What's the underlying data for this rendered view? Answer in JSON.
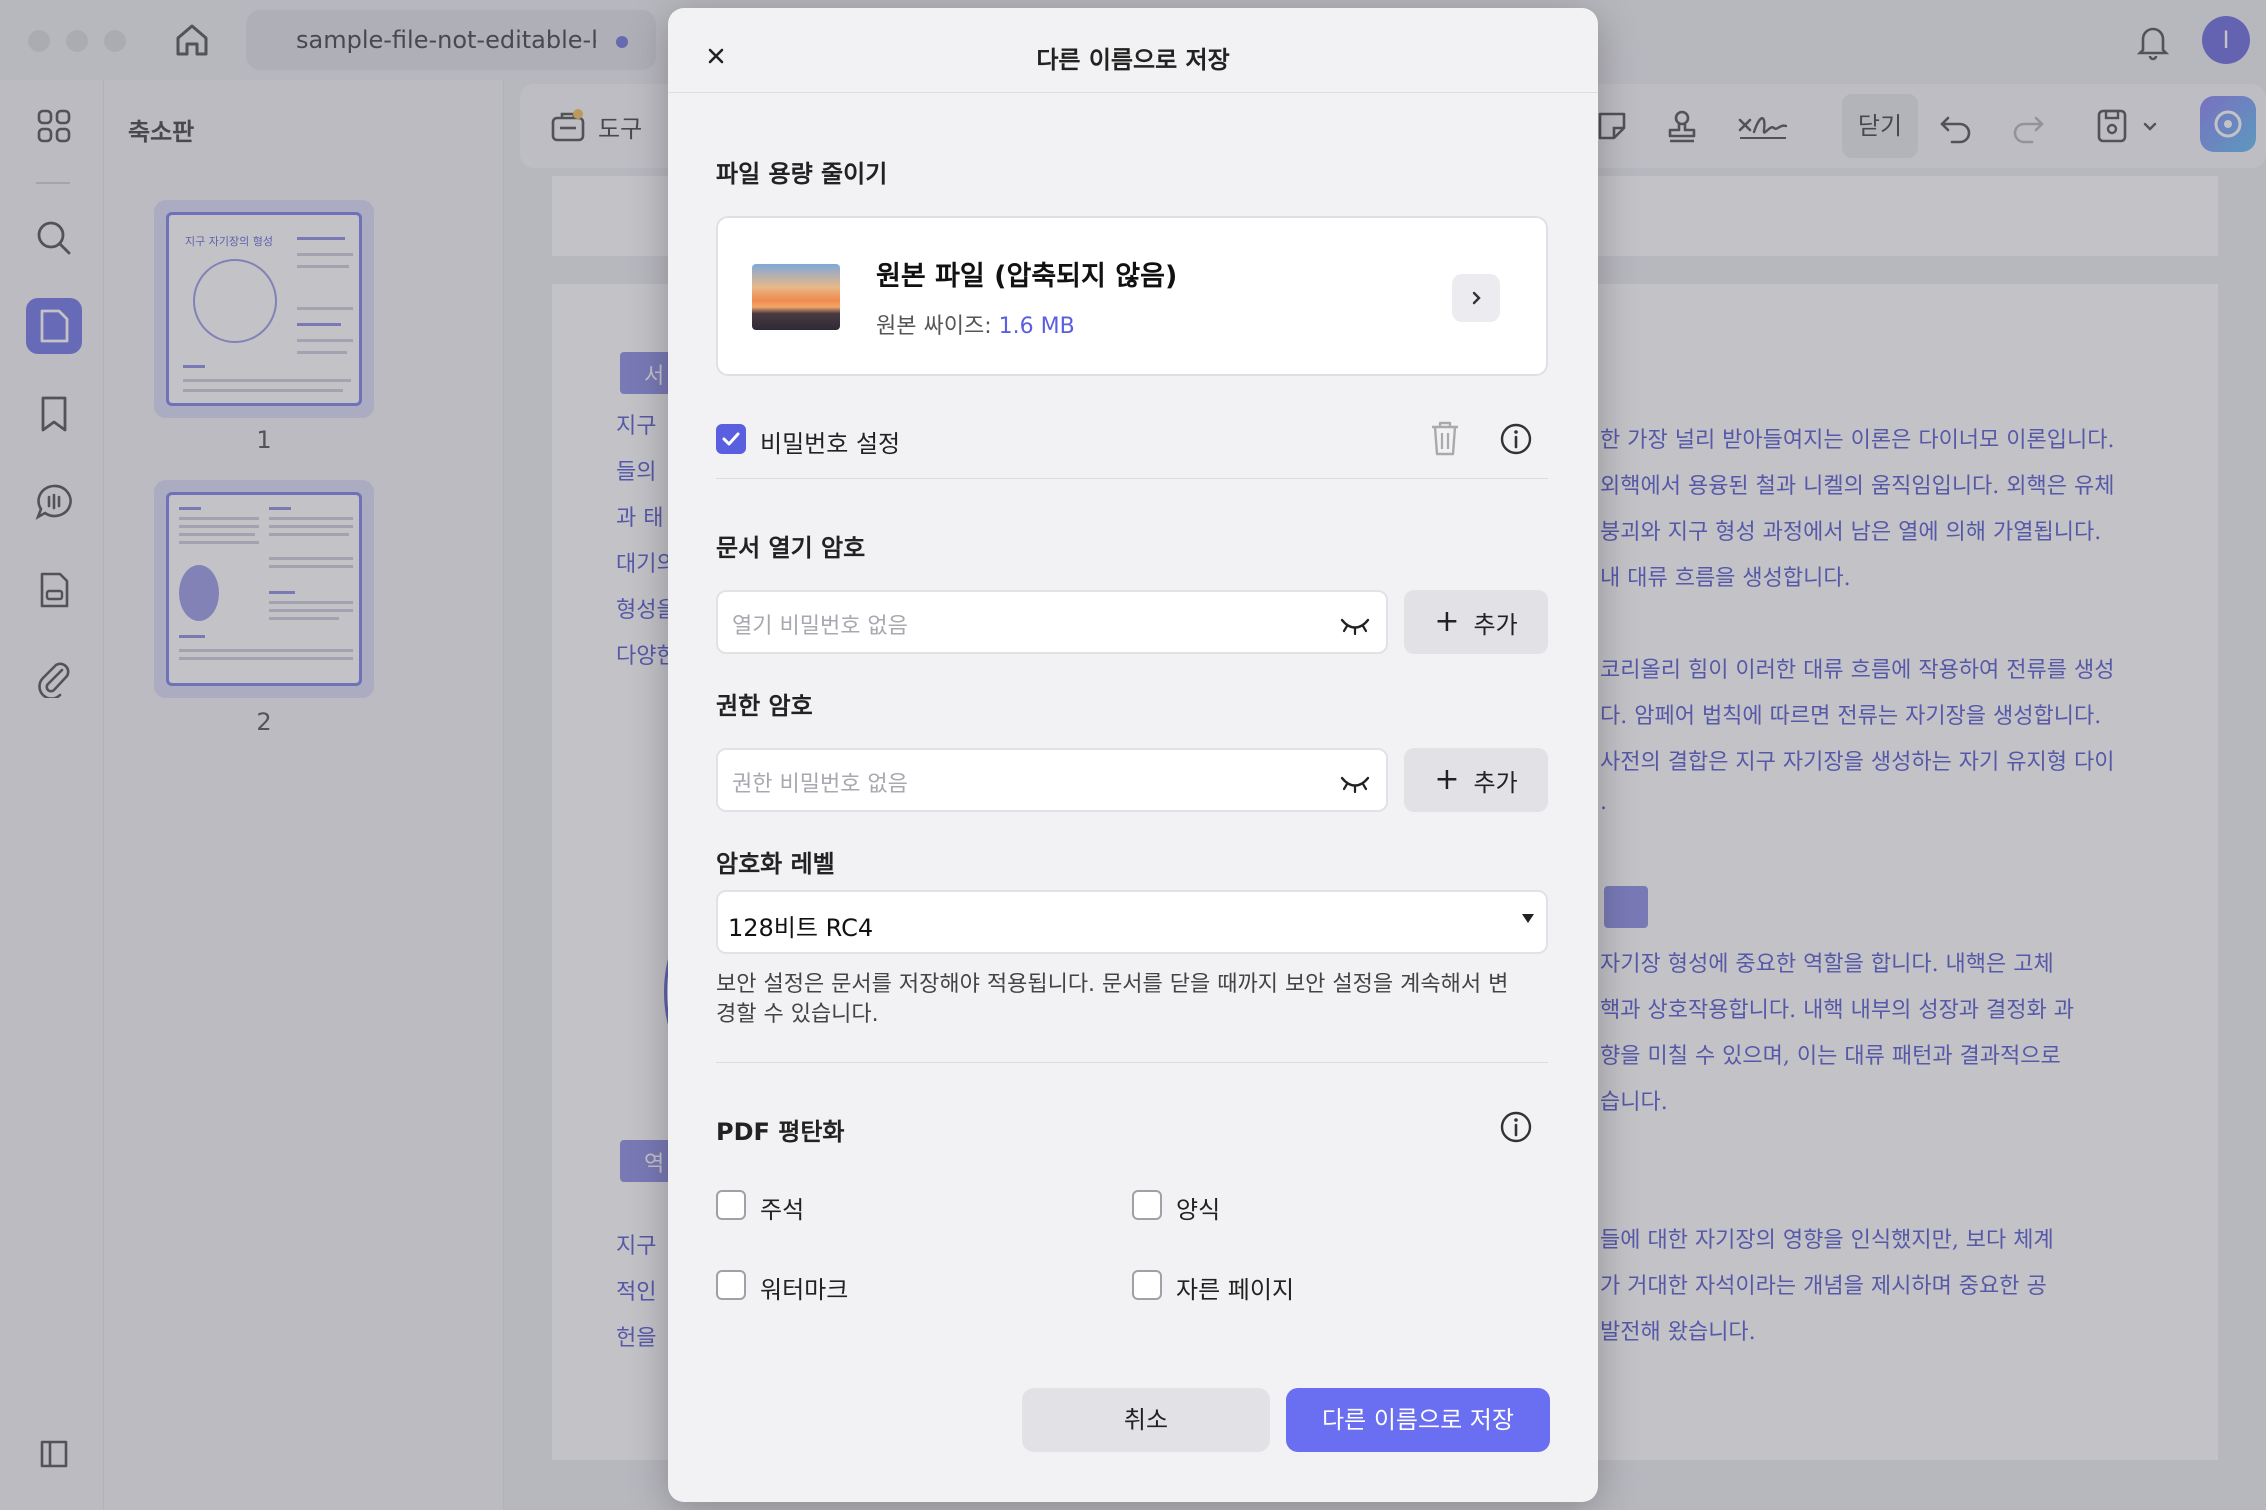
{
  "titlebar": {
    "tab_title": "sample-file-not-editable-k",
    "user_initial": "I"
  },
  "thumbnails": {
    "title": "축소판",
    "pages": [
      {
        "label": "1",
        "heading": "지구 자기장의 형성"
      },
      {
        "label": "2"
      }
    ]
  },
  "toolbar": {
    "tools_label": "도구",
    "close_label": "닫기"
  },
  "document": {
    "lines_right": [
      "한 가장 널리 받아들여지는 이론은 다이너모 이론입니다.",
      "외핵에서 용융된 철과 니켈의 움직임입니다. 외핵은 유체",
      "붕괴와 지구 형성 과정에서 남은 열에 의해 가열됩니다.",
      "내 대류 흐름을 생성합니다.",
      "코리올리 힘이 이러한 대류 흐름에 작용하여 전류를 생성",
      "다. 암페어 법칙에 따르면 전류는 자기장을 생성합니다.",
      "사전의 결합은 지구 자기장을 생성하는 자기 유지형 다이",
      ".",
      "자기장 형성에 중요한 역할을 합니다. 내핵은 고체",
      "핵과 상호작용합니다. 내핵 내부의 성장과 결정화 과",
      "향을 미칠 수 있으며, 이는 대류 패턴과 결과적으로",
      "습니다.",
      "들에 대한 자기장의 영향을 인식했지만, 보다 체계",
      "가 거대한 자석이라는 개념을 제시하며 중요한 공",
      "발전해 왔습니다."
    ],
    "lines_left": [
      "지구",
      "들의",
      "과 태",
      "대기의",
      "형성을",
      "다양한",
      "지구",
      "적인",
      "헌을"
    ],
    "tags": [
      "서",
      "역"
    ]
  },
  "dialog": {
    "title": "다른 이름으로 저장",
    "reduce_size": {
      "title": "파일 용량 줄이기",
      "file_name": "원본 파일 (압축되지 않음)",
      "size_label": "원본 싸이즈: ",
      "size_value": "1.6 MB"
    },
    "password": {
      "label": "비밀번호 설정",
      "checked": true,
      "open_title": "문서 열기 암호",
      "open_placeholder": "열기 비밀번호 없음",
      "perm_title": "권한 암호",
      "perm_placeholder": "권한 비밀번호 없음",
      "add_label": "추가",
      "encryption_title": "암호화 레벨",
      "encryption_value": "128비트 RC4",
      "note": "보안 설정은 문서를 저장해야 적용됩니다. 문서를 닫을 때까지 보안 설정을 계속해서 변경할 수 있습니다."
    },
    "flatten": {
      "title": "PDF 평탄화",
      "options": [
        "주석",
        "양식",
        "워터마크",
        "자른 페이지"
      ]
    },
    "buttons": {
      "cancel": "취소",
      "save": "다른 이름으로 저장"
    }
  },
  "colors": {
    "accent": "#5a5fe0",
    "doc_text": "#3b3ec6"
  }
}
